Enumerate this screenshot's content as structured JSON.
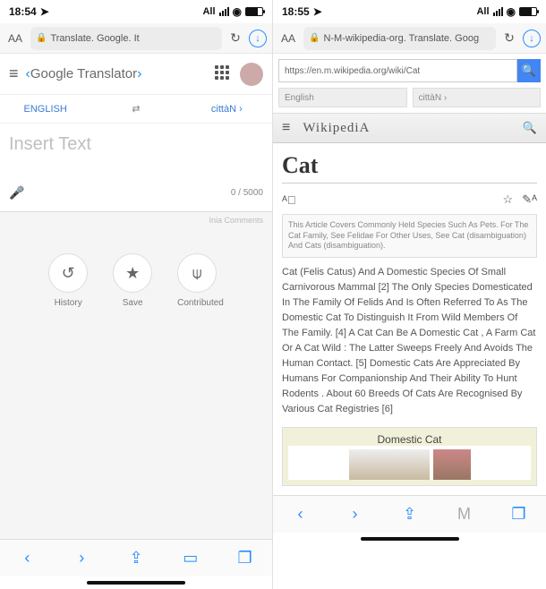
{
  "left": {
    "status": {
      "time": "18:54",
      "net": "All"
    },
    "addr": {
      "aa": "AA",
      "url": "Translate. Google. It"
    },
    "header": {
      "title": "Google Translator"
    },
    "langs": {
      "from": "ENGLISH",
      "to": "cittàN ›"
    },
    "input": {
      "placeholder": "Insert Text",
      "counter": "0 / 5000"
    },
    "inia": "Inia Comments",
    "actions": {
      "history": "History",
      "save": "Save",
      "contributed": "Contributed"
    }
  },
  "right": {
    "status": {
      "time": "18:55",
      "net": "All"
    },
    "addr": {
      "aa": "AA",
      "url": "N-M-wikipedia-org. Translate. Goog"
    },
    "search": {
      "value": "https://en.m.wikipedia.org/wiki/Cat"
    },
    "langs": {
      "from": "English",
      "to": "cittàN ›"
    },
    "wiki": {
      "logo": "WikipediA"
    },
    "article": {
      "title": "Cat",
      "disambig": "This Article Covers Commonly Held Species Such As Pets. For The Cat Family, See Felidae For Other Uses, See Cat (disambiguation) And Cats (disambiguation).",
      "body": "Cat (Felis Catus) And A Domestic Species Of Small Carnivorous Mammal [2] The Only Species Domesticated In The Family Of Felids And Is Often Referred To As The Domestic Cat To Distinguish It From Wild Members Of The Family. [4] A Cat Can Be A Domestic Cat , A Farm Cat Or A Cat Wild : The Latter Sweeps Freely And Avoids The Human Contact. [5] Domestic Cats Are Appreciated By Humans For Companionship And Their Ability To Hunt Rodents . About 60 Breeds Of Cats Are Recognised By Various Cat Registries [6]",
      "infobox": "Domestic Cat"
    }
  }
}
